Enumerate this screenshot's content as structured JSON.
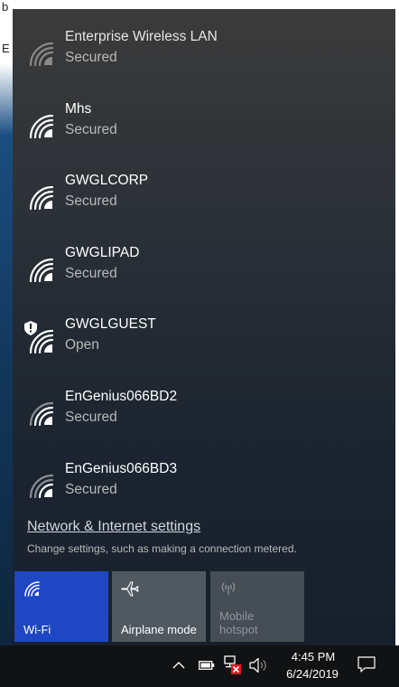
{
  "background": {
    "top_text": "b",
    "left_frag_1": "b",
    "left_frag_2": "E"
  },
  "networks": [
    {
      "name": "Enterprise Wireless LAN",
      "status": "Secured",
      "icon": "wifi-secured-icon",
      "dimmed": true
    },
    {
      "name": "Mhs",
      "status": "Secured",
      "icon": "wifi-secured-icon"
    },
    {
      "name": "GWGLCORP",
      "status": "Secured",
      "icon": "wifi-secured-icon"
    },
    {
      "name": "GWGLIPAD",
      "status": "Secured",
      "icon": "wifi-secured-icon"
    },
    {
      "name": "GWGLGUEST",
      "status": "Open",
      "icon": "wifi-open-shield-icon"
    },
    {
      "name": "EnGenius066BD2",
      "status": "Secured",
      "icon": "wifi-secured-icon"
    },
    {
      "name": "EnGenius066BD3",
      "status": "Secured",
      "icon": "wifi-secured-icon"
    }
  ],
  "settings": {
    "link": "Network & Internet settings",
    "description": "Change settings, such as making a connection metered."
  },
  "quick_actions": {
    "wifi": {
      "label": "Wi-Fi",
      "icon": "wifi-icon",
      "active": true
    },
    "airplane": {
      "label": "Airplane mode",
      "icon": "airplane-icon",
      "active": false
    },
    "hotspot": {
      "label_line1": "Mobile",
      "label_line2": "hotspot",
      "icon": "hotspot-icon",
      "disabled": true
    }
  },
  "taskbar": {
    "time": "4:45 PM",
    "date": "6/24/2019",
    "icons": [
      "chevron-up-icon",
      "battery-icon",
      "network-disconnected-icon",
      "volume-icon",
      "notification-icon"
    ]
  },
  "colors": {
    "wifi_tile_active": "#1f47c4",
    "panel_top": "#3b3b3b",
    "panel_bottom": "#17202b",
    "taskbar": "#101214"
  }
}
